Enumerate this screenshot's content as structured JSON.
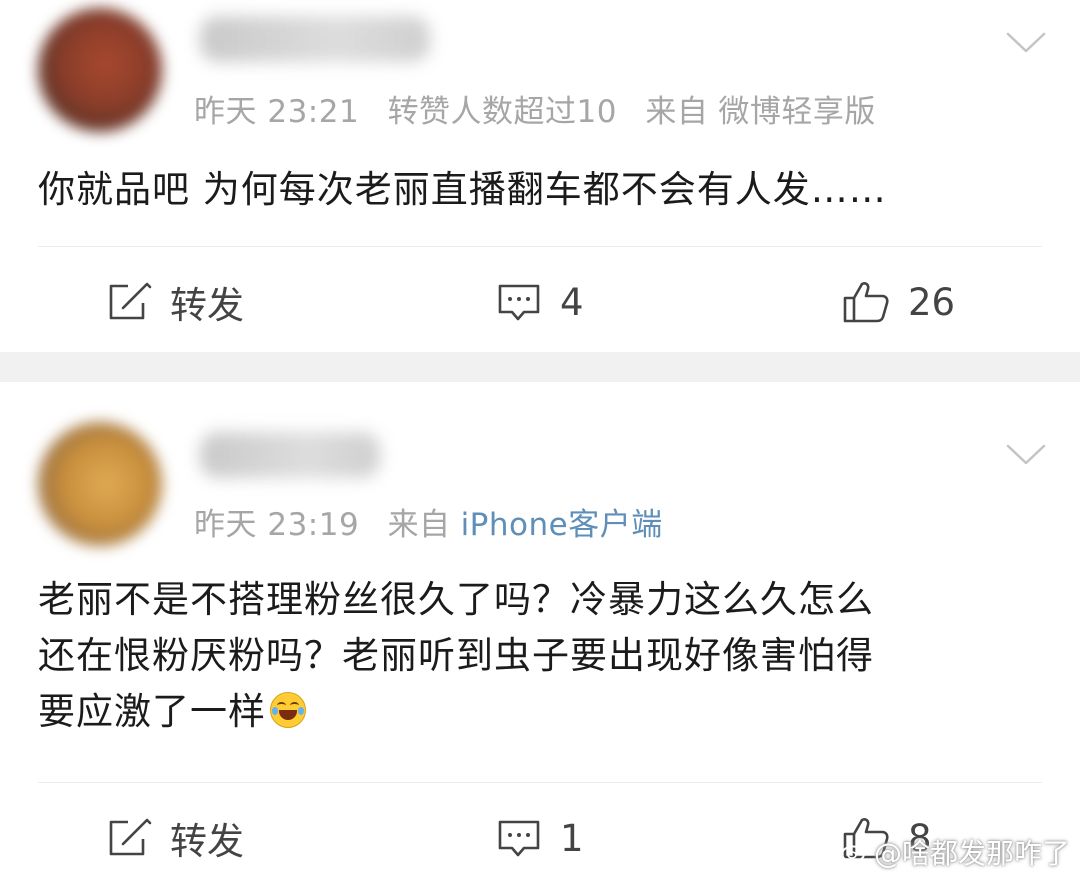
{
  "posts": [
    {
      "username": "",
      "time": "昨天 23:21",
      "repost_note": "转赞人数超过10",
      "source_prefix": "来自",
      "source_name": "微博轻享版",
      "content": "你就品吧 为何每次老丽直播翻车都不会有人发……",
      "actions": {
        "repost_label": "转发",
        "comment_count": "4",
        "like_count": "26"
      }
    },
    {
      "username": "",
      "time": "昨天 23:19",
      "source_prefix": "来自",
      "source_name": "iPhone客户端",
      "content_lines": [
        "老丽不是不搭理粉丝很久了吗？冷暴力这么久怎么",
        "还在恨粉厌粉吗？老丽听到虫子要出现好像害怕得",
        "要应激了一样"
      ],
      "emoji": "laughing-tears-emoji",
      "actions": {
        "repost_label": "转发",
        "comment_count": "1",
        "like_count": "8"
      }
    }
  ],
  "watermark": {
    "text": "@啥都发那咋了",
    "icon": "weibo-logo-icon"
  },
  "icons": {
    "more": "chevron-down-icon",
    "repost": "repost-icon",
    "comment": "comment-icon",
    "like": "thumbs-up-icon"
  },
  "colors": {
    "meta_text": "#a6a6a6",
    "source_link": "#5f8fb8",
    "body_text": "#1b1b1b",
    "action_text": "#444444",
    "separator": "#f1f1f1"
  }
}
